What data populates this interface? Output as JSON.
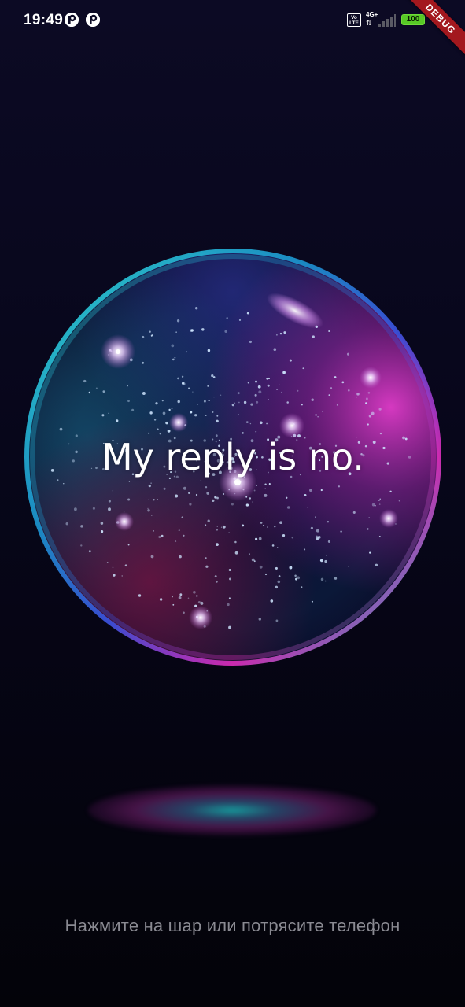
{
  "status_bar": {
    "time": "19:49",
    "notification_icons": [
      "p-notification-icon",
      "p-notification-icon"
    ],
    "volte_label": "Vo\nLTE",
    "network_type": "4G+",
    "network_arrows": "⇅",
    "battery_level": "100",
    "battery_color": "#58c926"
  },
  "debug_banner": {
    "label": "DEBUG"
  },
  "orb": {
    "answer": "My reply is no.",
    "colors": {
      "rim_teal": "#1fc9c0",
      "rim_magenta": "#d62bb8",
      "core": "#0a0b2a"
    }
  },
  "hint": {
    "text": "Нажмите на шар или потрясите телефон"
  }
}
